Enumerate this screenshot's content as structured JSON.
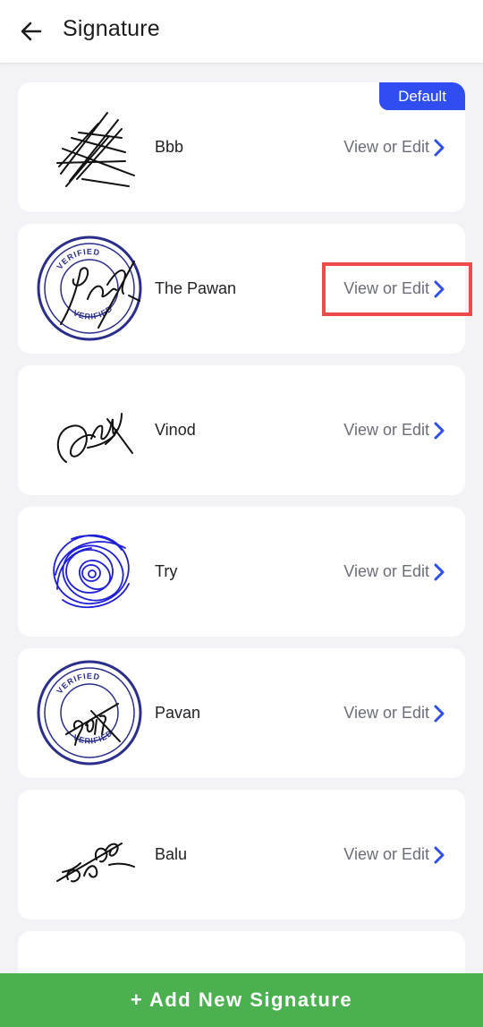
{
  "header": {
    "title": "Signature",
    "back_icon": "arrow-left-icon"
  },
  "signatures": [
    {
      "name": "Bbb",
      "action": "View or Edit",
      "badge": "Default",
      "style": "hatched"
    },
    {
      "name": "The Pawan",
      "action": "View or Edit",
      "style": "verified-stamp",
      "stamp_text": "VERIFIED"
    },
    {
      "name": "Vinod",
      "action": "View or Edit",
      "style": "scribble"
    },
    {
      "name": "Try",
      "action": "View or Edit",
      "style": "blue-scribble"
    },
    {
      "name": "Pavan",
      "action": "View or Edit",
      "style": "verified-stamp",
      "stamp_text": "VERIFIED"
    },
    {
      "name": "Balu",
      "action": "View or Edit",
      "style": "script"
    }
  ],
  "footer": {
    "add_button": "+ Add New Signature"
  },
  "colors": {
    "accent": "#2f4df0",
    "add_button": "#4caf50",
    "highlight": "#ee4b4b",
    "stamp": "#2b2e8a"
  }
}
